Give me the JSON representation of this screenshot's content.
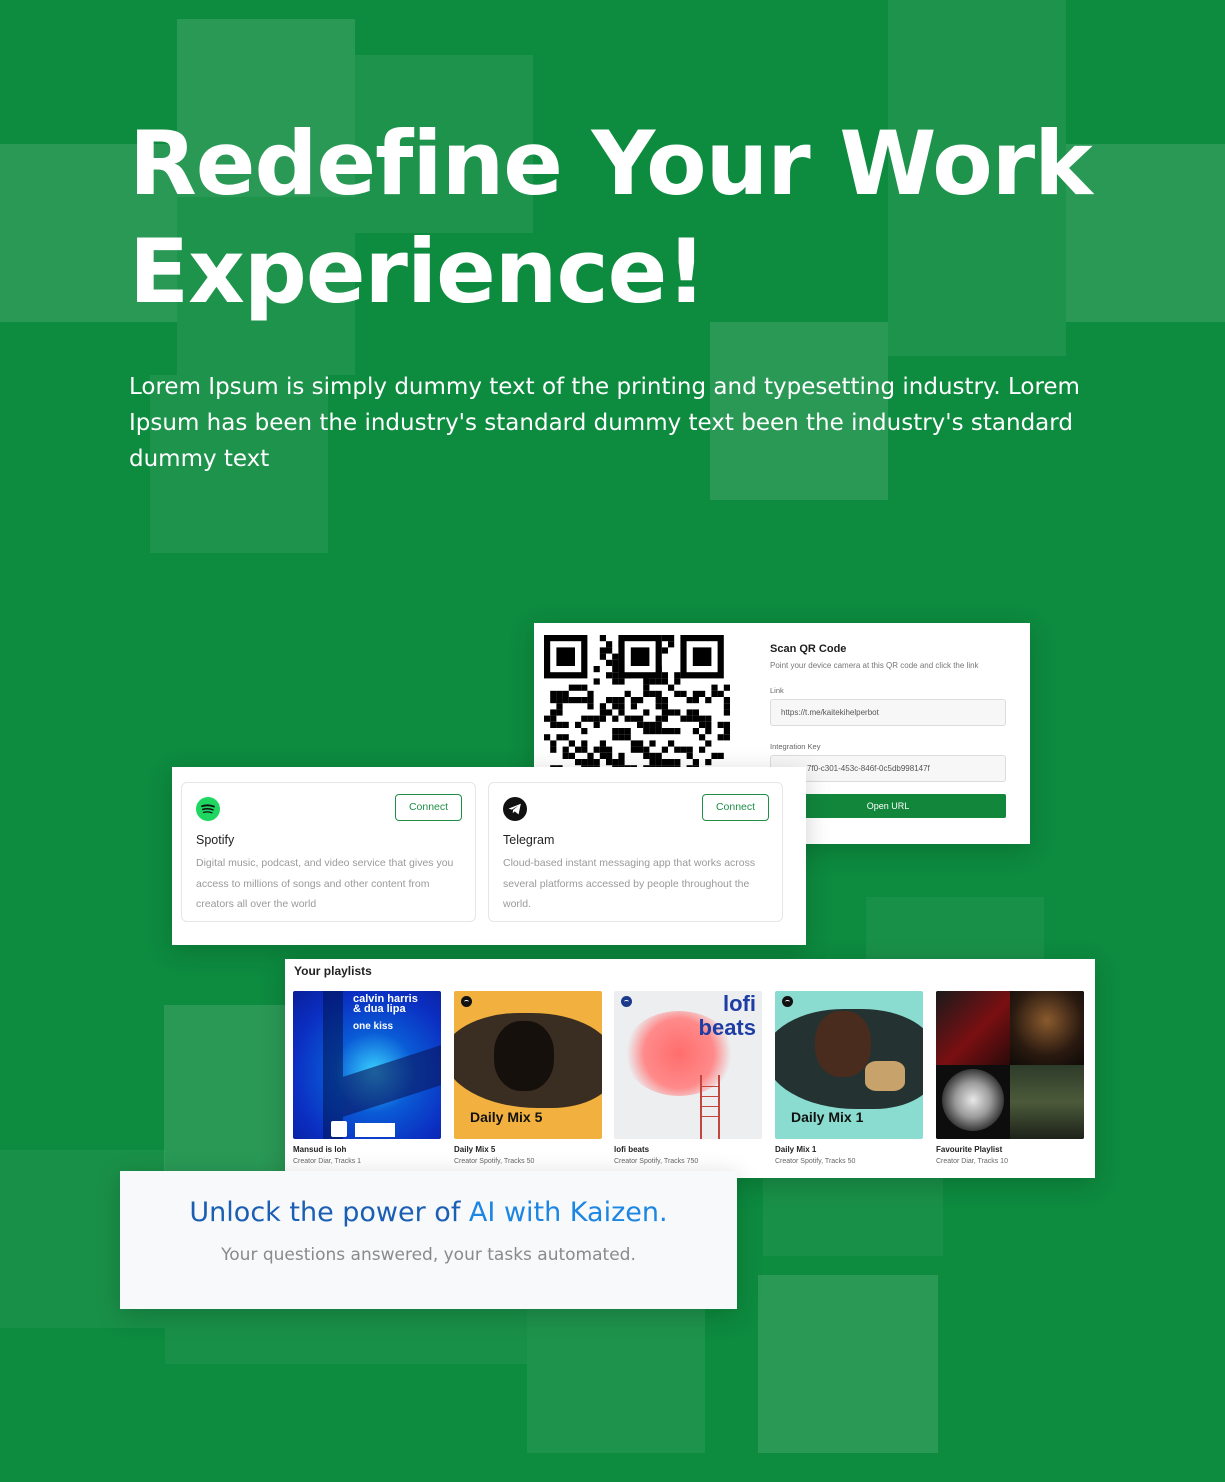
{
  "hero": {
    "title_line1": "Redefine Your Work",
    "title_line2": "Experience!",
    "subtitle": "Lorem Ipsum is simply dummy text of the printing and typesetting industry. Lorem Ipsum has been the industry's standard dummy text been the industry's standard dummy text"
  },
  "qr": {
    "title": "Scan QR Code",
    "description": "Point your device camera at this QR code and click the link",
    "link_label": "Link",
    "link_value": "https://t.me/kaitekihelperbot",
    "key_label": "Integration Key",
    "key_value": "7f0-c301-453c-846f-0c5db998147f",
    "button": "Open URL"
  },
  "apps": [
    {
      "name": "Spotify",
      "icon": "spotify-icon",
      "description": "Digital music, podcast, and video service that gives you access to millions of songs and other content from creators all over the world",
      "button": "Connect"
    },
    {
      "name": "Telegram",
      "icon": "telegram-icon",
      "description": "Cloud-based instant messaging app that works across several platforms accessed by people throughout the world.",
      "button": "Connect"
    }
  ],
  "playlists": {
    "heading": "Your playlists",
    "items": [
      {
        "name": "Mansud is loh",
        "meta": "Creator Diar, Tracks 1",
        "cover_line1": "calvin harris",
        "cover_line2": "& dua lipa",
        "cover_line3": "one kiss"
      },
      {
        "name": "Daily Mix 5",
        "meta": "Creator Spotify, Tracks 50",
        "cover_text": "Daily Mix 5"
      },
      {
        "name": "lofi beats",
        "meta": "Creator Spotify, Tracks 750",
        "cover_line1": "lofi",
        "cover_line2": "beats"
      },
      {
        "name": "Daily Mix 1",
        "meta": "Creator Spotify, Tracks 50",
        "cover_text": "Daily Mix 1"
      },
      {
        "name": "Favourite Playlist",
        "meta": "Creator Diar, Tracks 10"
      }
    ]
  },
  "kaizen": {
    "title_part1": "Unlock the power of ",
    "title_part2": "AI with Kaizen.",
    "subtitle": "Your questions answered, your tasks automated."
  },
  "colors": {
    "background": "#0d8b3f",
    "accent": "#12873c",
    "kaizen_blue": "#1a5fb4"
  }
}
